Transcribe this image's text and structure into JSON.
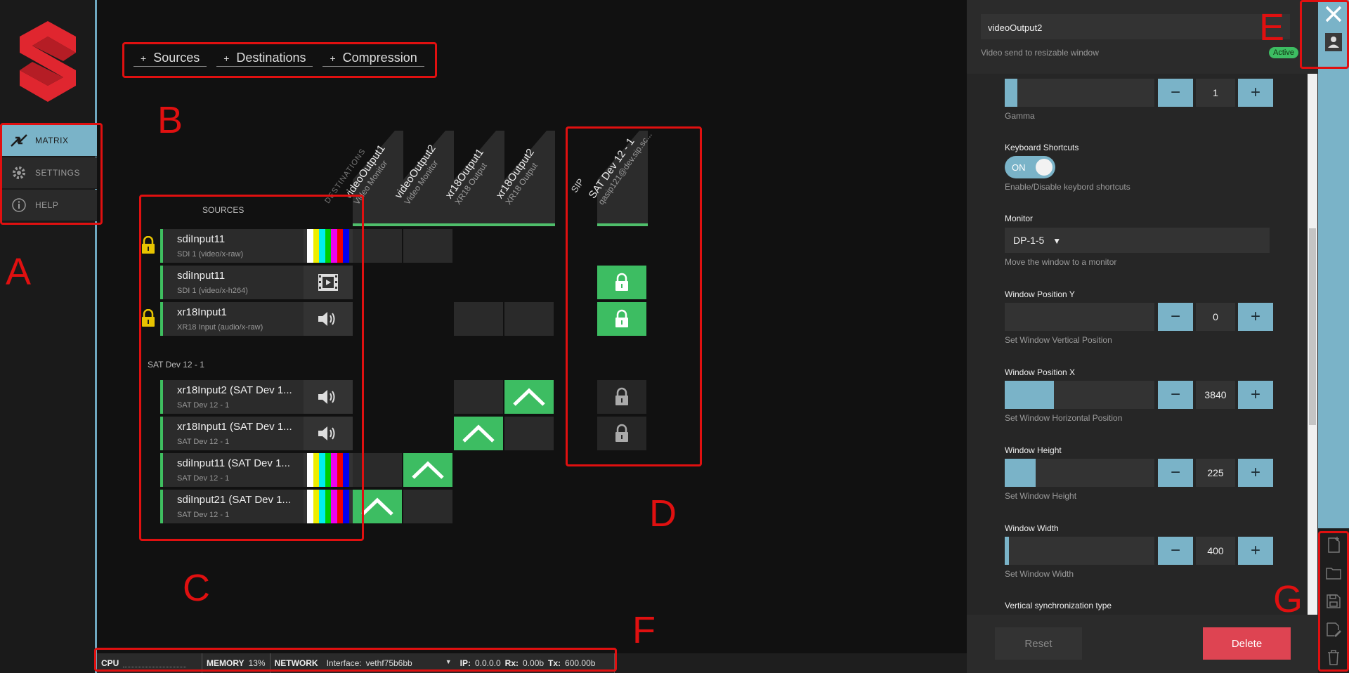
{
  "nav": {
    "items": [
      {
        "label": "MATRIX",
        "icon": "matrix-arrows-icon"
      },
      {
        "label": "SETTINGS",
        "icon": "gear-icon"
      },
      {
        "label": "HELP",
        "icon": "info-icon"
      }
    ]
  },
  "toolbar": {
    "sources_label": "Sources",
    "destinations_label": "Destinations",
    "compression_label": "Compression",
    "plus": "+"
  },
  "matrix": {
    "destinations_header": "DESTINATIONS",
    "sources_header": "SOURCES",
    "sip_header": "SIP",
    "columns": [
      {
        "title": "videoOutput1",
        "subtitle": "Video Monitor"
      },
      {
        "title": "videoOutput2",
        "subtitle": "Video Monitor"
      },
      {
        "title": "xr18Output1",
        "subtitle": "XR18 Output"
      },
      {
        "title": "xr18Output2",
        "subtitle": "XR18 Output"
      }
    ],
    "sip_column": {
      "title": "SAT Dev 12 - 1",
      "subtitle": "qasip121@dev.sip.sc..."
    },
    "local_sources": [
      {
        "name": "sdiInput11",
        "sub": "SDI 1 (video/x-raw)",
        "thumb": "color-bars",
        "locked": true
      },
      {
        "name": "sdiInput11",
        "sub": "SDI 1 (video/x-h264)",
        "thumb": "film-icon",
        "locked": false
      },
      {
        "name": "xr18Input1",
        "sub": "XR18 Input (audio/x-raw)",
        "thumb": "speaker-icon",
        "locked": true
      }
    ],
    "group_label": "SAT Dev 12 - 1",
    "remote_sources": [
      {
        "name": "xr18Input2 (SAT Dev 1...",
        "sub": "SAT Dev 12 - 1",
        "thumb": "speaker-icon"
      },
      {
        "name": "xr18Input1 (SAT Dev 1...",
        "sub": "SAT Dev 12 - 1",
        "thumb": "speaker-icon"
      },
      {
        "name": "sdiInput11 (SAT Dev 1...",
        "sub": "SAT Dev 12 - 1",
        "thumb": "color-bars"
      },
      {
        "name": "sdiInput21 (SAT Dev 1...",
        "sub": "SAT Dev 12 - 1",
        "thumb": "color-bars"
      }
    ]
  },
  "panel": {
    "name": "videoOutput2",
    "description": "Video send to resizable window",
    "status": "Active",
    "gamma_label": "Gamma",
    "gamma_value": "1",
    "keyboard_label": "Keyboard Shortcuts",
    "keyboard_state": "ON",
    "keyboard_help": "Enable/Disable keybord shortcuts",
    "monitor_label": "Monitor",
    "monitor_value": "DP-1-5",
    "monitor_help": "Move the window to a monitor",
    "wpy_label": "Window Position Y",
    "wpy_value": "0",
    "wpy_help": "Set Window Vertical Position",
    "wpx_label": "Window Position X",
    "wpx_value": "3840",
    "wpx_help": "Set Window Horizontal Position",
    "wh_label": "Window Height",
    "wh_value": "225",
    "wh_help": "Set Window Height",
    "ww_label": "Window Width",
    "ww_value": "400",
    "ww_help": "Set Window Width",
    "vsync_label": "Vertical synchronization type",
    "reset_label": "Reset",
    "delete_label": "Delete",
    "minus": "−",
    "plus": "+"
  },
  "statusbar": {
    "cpu_label": "CPU",
    "memory_label": "MEMORY",
    "memory_value": "13%",
    "network_label": "NETWORK",
    "interface_label": "Interface:",
    "interface_value": "vethf75b6bb",
    "ip_label": "IP:",
    "ip_value": "0.0.0.0",
    "rx_label": "Rx:",
    "rx_value": "0.00b",
    "tx_label": "Tx:",
    "tx_value": "600.00b"
  },
  "annotations": [
    "A",
    "B",
    "C",
    "D",
    "E",
    "F",
    "G"
  ],
  "colors": {
    "accent": "#7ab3c8",
    "green": "#3dbd62",
    "annotation": "#e01010",
    "delete": "#de4452"
  }
}
